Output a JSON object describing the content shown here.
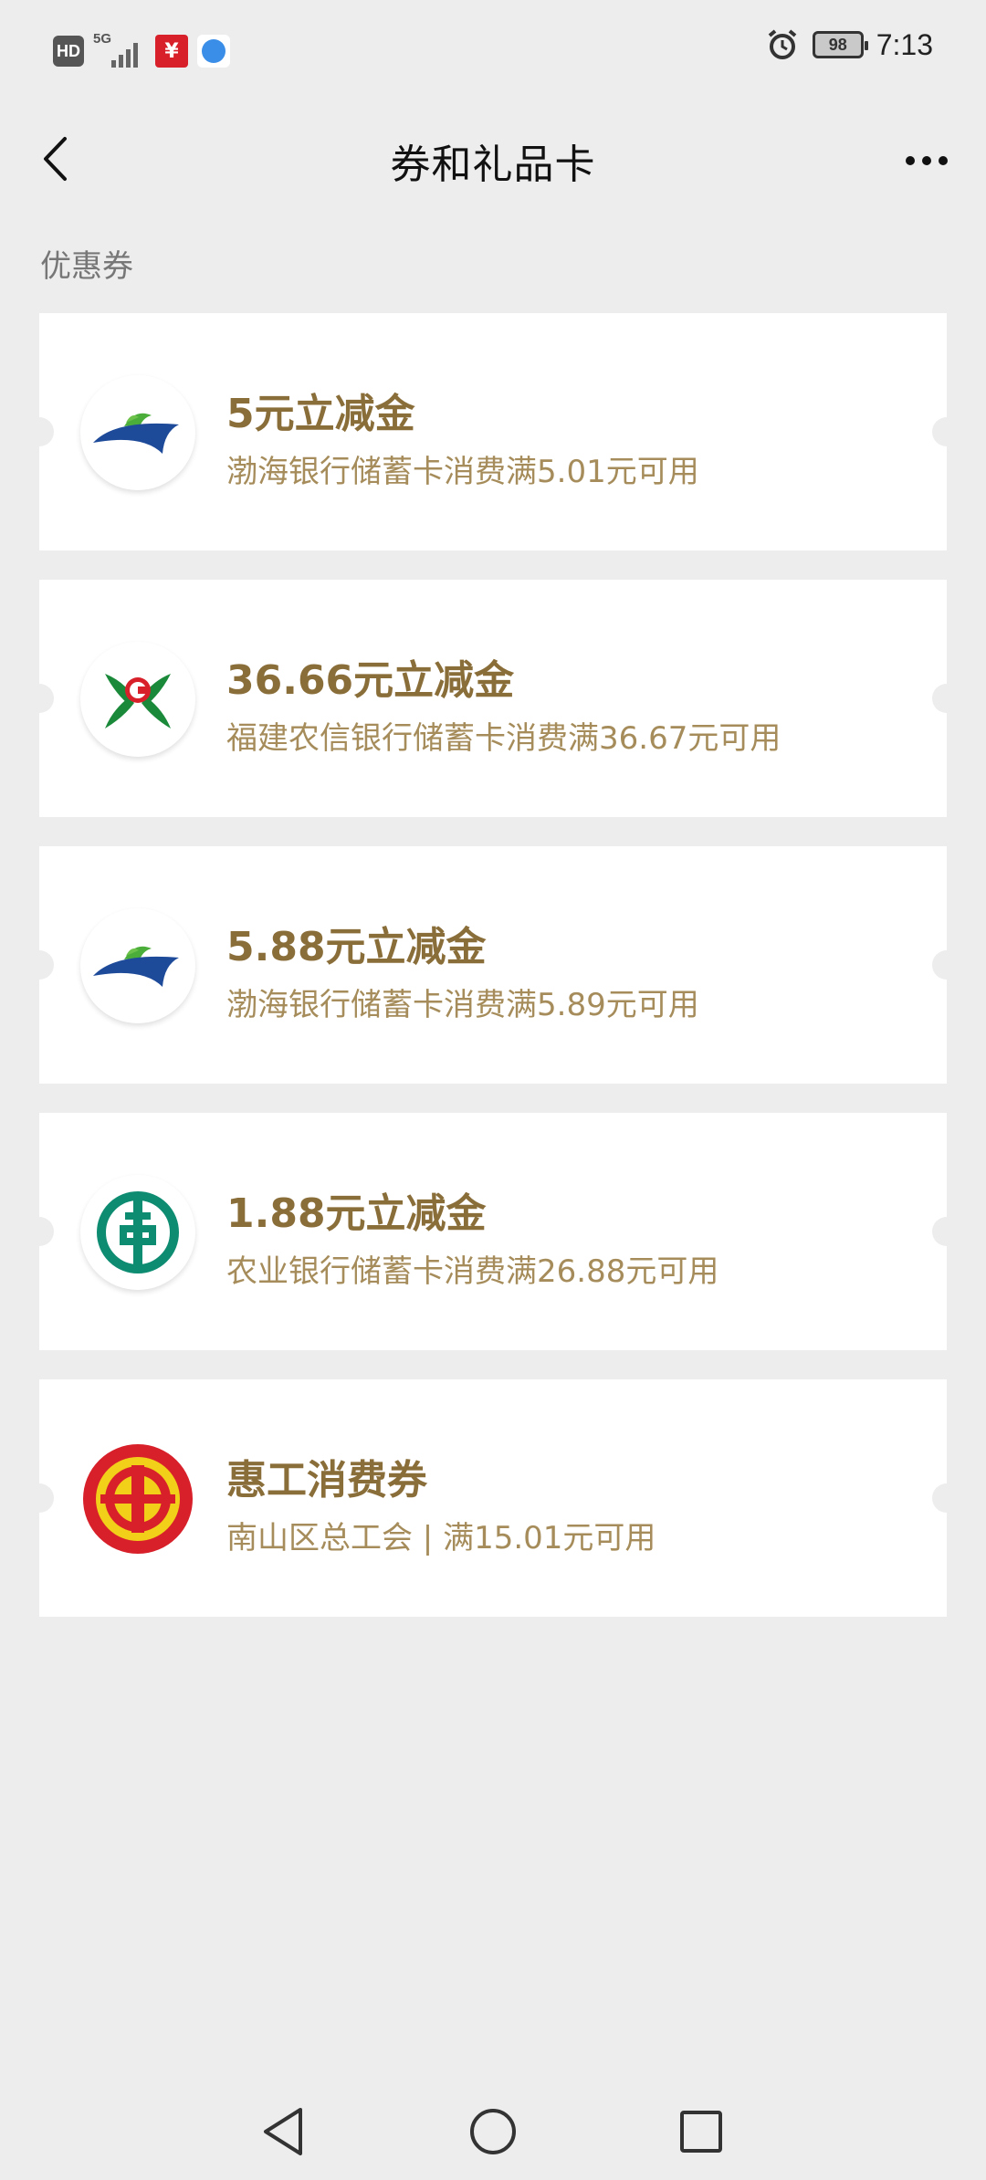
{
  "status_bar": {
    "hd_label": "HD",
    "network_label": "5G",
    "battery_level": "98",
    "time": "7:13",
    "icons": [
      "hd-icon",
      "signal-icon",
      "unionpay-app-icon",
      "browser-app-icon",
      "alarm-icon",
      "battery-icon"
    ]
  },
  "header": {
    "title": "券和礼品卡",
    "back_icon": "chevron-left-icon",
    "more_icon": "more-dots-icon"
  },
  "section_label": "优惠券",
  "coupons": [
    {
      "title": "5元立减金",
      "description": "渤海银行储蓄卡消费满5.01元可用",
      "logo": "bohai-bank-logo"
    },
    {
      "title": "36.66元立减金",
      "description": "福建农信银行储蓄卡消费满36.67元可用",
      "logo": "fujian-rural-credit-logo"
    },
    {
      "title": "5.88元立减金",
      "description": "渤海银行储蓄卡消费满5.89元可用",
      "logo": "bohai-bank-logo"
    },
    {
      "title": "1.88元立减金",
      "description": "农业银行储蓄卡消费满26.88元可用",
      "logo": "abc-bank-logo"
    },
    {
      "title": "惠工消费券",
      "description": "南山区总工会 | 满15.01元可用",
      "logo": "trade-union-logo"
    }
  ],
  "colors": {
    "background": "#ededed",
    "coupon_title": "#8a6e3a",
    "coupon_desc": "#a58c5a"
  },
  "nav_bar": {
    "icons": [
      "back-triangle-icon",
      "home-circle-icon",
      "recents-square-icon"
    ]
  }
}
